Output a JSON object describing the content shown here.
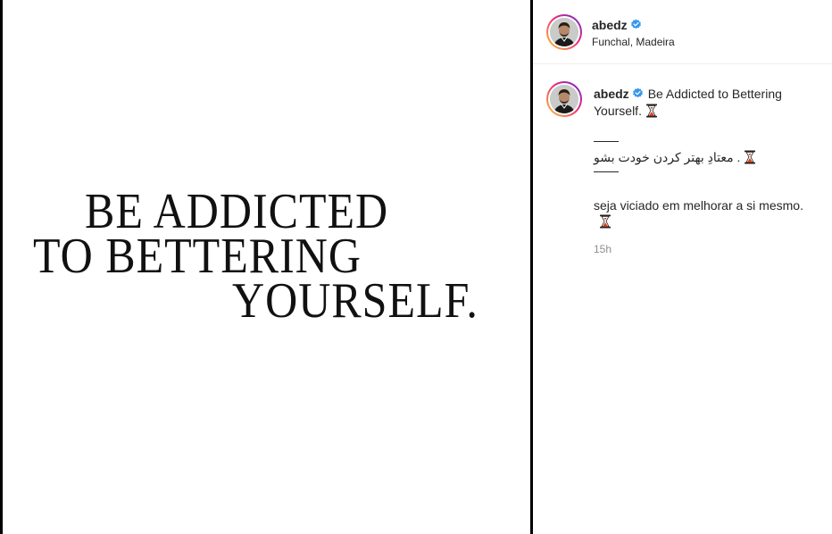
{
  "post": {
    "quote_lines": [
      "BE ADDICTED",
      "TO BETTERING",
      "YOURSELF."
    ]
  },
  "header": {
    "username": "abedz",
    "location": "Funchal, Madeira"
  },
  "caption": {
    "username": "abedz",
    "english_line1": "Be Addicted to Bettering",
    "english_line2": "Yourself.",
    "persian": "معتادِ بهتر کردن خودت بشو .",
    "portuguese": "seja viciado em melhorar a si mesmo.",
    "timestamp": "15h"
  },
  "colors": {
    "verified_blue": "#3897f0",
    "emoji_red": "#e0401a"
  },
  "icons": {
    "verified": "verified-badge-icon",
    "emoji": "hourglass-emoji-icon"
  }
}
